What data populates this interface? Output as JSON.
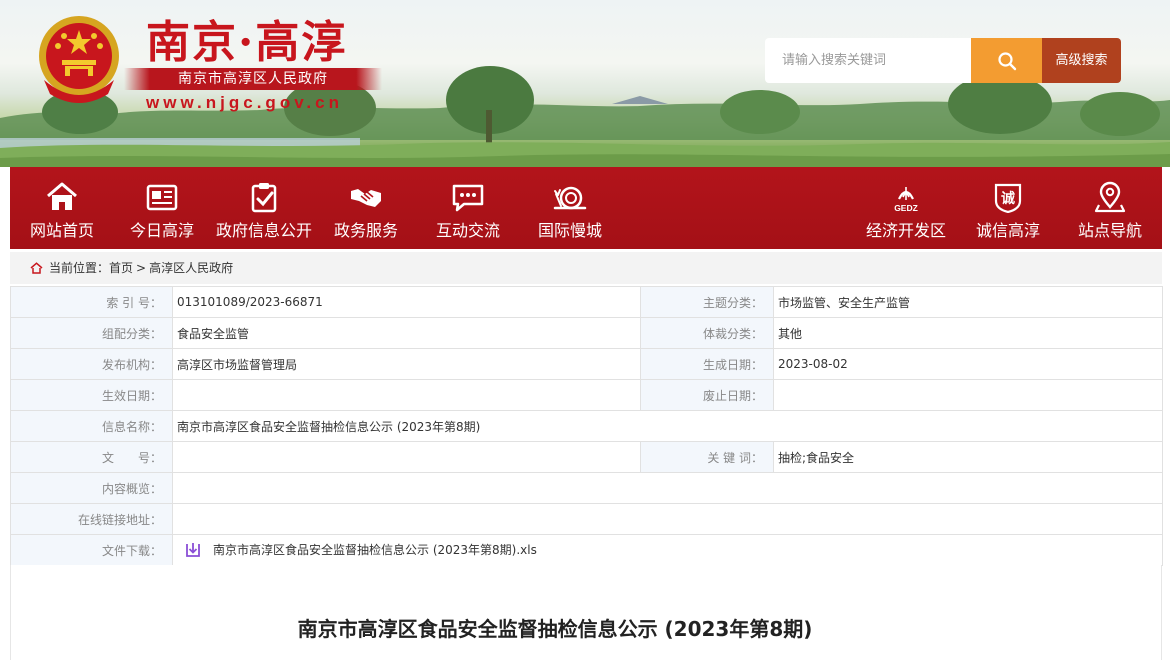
{
  "header": {
    "site_name": "南京·高淳",
    "gov_name": "南京市高淳区人民政府",
    "site_url": "www.njgc.gov.cn",
    "emblem_icon": "national-emblem-icon"
  },
  "search": {
    "placeholder": "请输入搜索关键词",
    "icon": "search-icon",
    "advanced_label": "高级搜索"
  },
  "nav": {
    "left_items": [
      {
        "label": "网站首页",
        "icon": "home-icon"
      },
      {
        "label": "今日高淳",
        "icon": "news-icon"
      },
      {
        "label": "政府信息公开",
        "icon": "checklist-icon"
      },
      {
        "label": "政务服务",
        "icon": "handshake-icon"
      },
      {
        "label": "互动交流",
        "icon": "chat-icon"
      },
      {
        "label": "国际慢城",
        "icon": "snail-icon"
      }
    ],
    "right_items": [
      {
        "label": "经济开发区",
        "icon": "gedz-logo-icon",
        "logo_text": "GEDZ"
      },
      {
        "label": "诚信高淳",
        "icon": "integrity-icon",
        "logo_text": "诚"
      },
      {
        "label": "站点导航",
        "icon": "location-pin-icon"
      }
    ]
  },
  "breadcrumb": {
    "prefix": "当前位置：",
    "items": [
      "首页",
      "高淳区人民政府"
    ],
    "separator": ">"
  },
  "info": {
    "index_no_label": "索 引 号：",
    "index_no": "013101089/2023-66871",
    "topic_label": "主题分类：",
    "topic": "市场监管、安全生产监管",
    "category_label": "组配分类：",
    "category": "食品安全监管",
    "genre_label": "体裁分类：",
    "genre": "其他",
    "publisher_label": "发布机构：",
    "publisher": "高淳区市场监督管理局",
    "created_label": "生成日期：",
    "created": "2023-08-02",
    "effective_label": "生效日期：",
    "effective": "",
    "expiry_label": "废止日期：",
    "expiry": "",
    "title_label": "信息名称：",
    "title": "南京市高淳区食品安全监督抽检信息公示 (2023年第8期)",
    "doc_no_label": "文　　号：",
    "doc_no": "",
    "keywords_label": "关 键 词：",
    "keywords": "抽检;食品安全",
    "summary_label": "内容概览：",
    "summary": "",
    "online_link_label": "在线链接地址：",
    "online_link": "",
    "download_label": "文件下载：",
    "download_file": "南京市高淳区食品安全监督抽检信息公示 (2023年第8期).xls"
  },
  "article": {
    "title": "南京市高淳区食品安全监督抽检信息公示 (2023年第8期)"
  },
  "colors": {
    "nav_red": "#b3141b",
    "brand_red": "#c8161d",
    "search_orange": "#f39c31",
    "advanced_brown": "#b0411e",
    "label_bg": "#f3f7fc"
  }
}
